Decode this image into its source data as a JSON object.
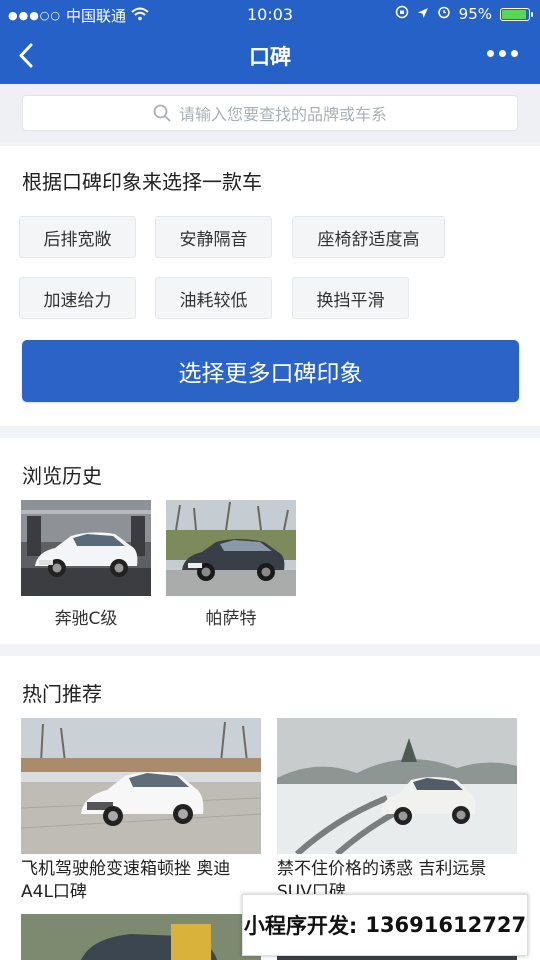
{
  "status_bar": {
    "carrier": "中国联通",
    "time": "10:03",
    "battery": "95%",
    "battery_level": 0.95,
    "icons": [
      "signal-dots-icon",
      "wifi-icon",
      "lock-rotation-icon",
      "location-icon",
      "alarm-icon",
      "battery-icon"
    ]
  },
  "nav": {
    "title": "口碑",
    "back_icon": "chevron-left-icon",
    "more_icon": "more-dots-icon"
  },
  "search": {
    "placeholder": "请输入您要查找的品牌或车系",
    "icon": "search-icon"
  },
  "impression": {
    "title": "根据口碑印象来选择一款车",
    "tags": [
      "后排宽敞",
      "安静隔音",
      "座椅舒适度高",
      "加速给力",
      "油耗较低",
      "换挡平滑"
    ],
    "more_button": "选择更多口碑印象"
  },
  "history": {
    "title": "浏览历史",
    "items": [
      {
        "label": "奔驰C级"
      },
      {
        "label": "帕萨特"
      }
    ]
  },
  "hot": {
    "title": "热门推荐",
    "items": [
      {
        "caption": "飞机驾驶舱变速箱顿挫 奥迪A4L口碑"
      },
      {
        "caption": "禁不住价格的诱惑 吉利远景SUV口碑"
      }
    ]
  },
  "promo": {
    "label": "小程序开发:",
    "phone": "13691612727"
  },
  "colors": {
    "brand_blue": "#2561c6",
    "button_blue": "#2c63c6",
    "battery_green": "#5ad55a"
  }
}
